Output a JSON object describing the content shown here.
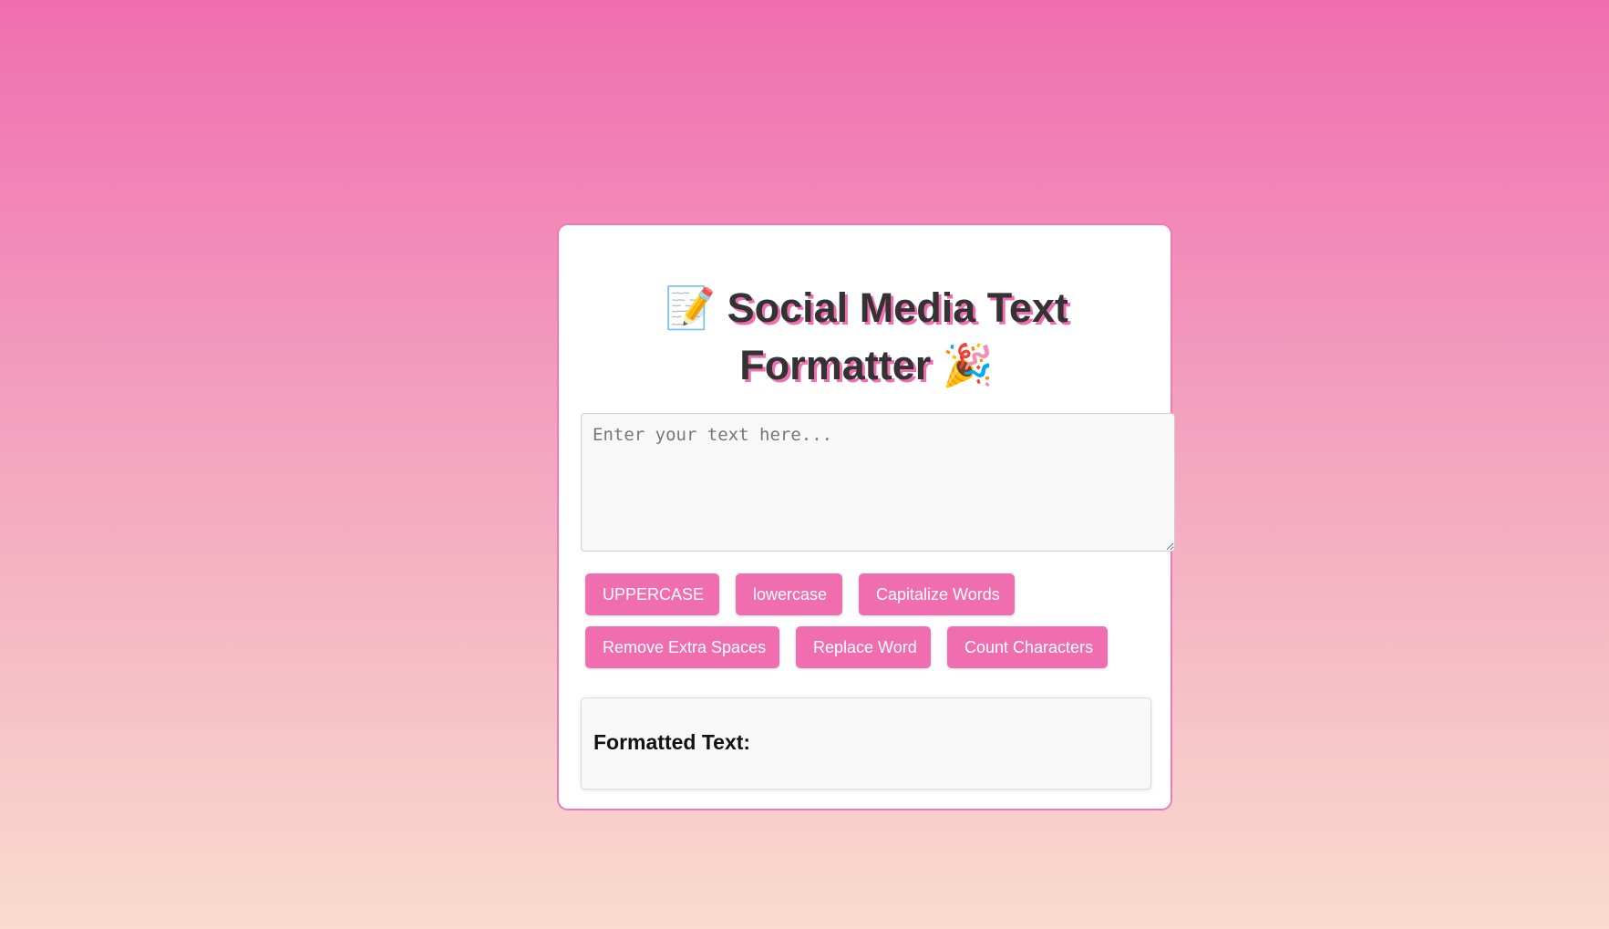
{
  "app": {
    "title_line1": "Social Media Text",
    "title_line2": "Formatter",
    "title_icon_left": "memo-icon",
    "title_icon_right": "party-popper-icon",
    "title_icon_left_glyph": "📝",
    "title_icon_right_glyph": "🎉"
  },
  "input": {
    "placeholder": "Enter your text here...",
    "value": ""
  },
  "buttons": {
    "uppercase": "UPPERCASE",
    "lowercase": "lowercase",
    "capitalize": "Capitalize Words",
    "remove_spaces": "Remove Extra Spaces",
    "replace_word": "Replace Word",
    "count_characters": "Count Characters"
  },
  "output": {
    "heading": "Formatted Text:",
    "value": ""
  },
  "colors": {
    "accent": "#f06eb0",
    "title_text": "#333333",
    "background_top": "#f06eb0",
    "background_bottom": "#f9dccd"
  }
}
